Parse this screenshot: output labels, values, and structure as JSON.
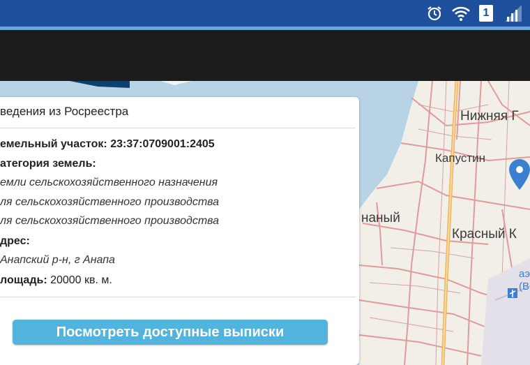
{
  "status_bar": {
    "icons": [
      "alarm-icon",
      "wifi-icon",
      "sim-icon",
      "signal-icon"
    ],
    "sim_badge": "1",
    "color": "#1e4f9c"
  },
  "map": {
    "places": {
      "nizhnyaya": "Нижняя Г",
      "kapustin": "Капустин",
      "krasny": "Красный К",
      "nany": "наный",
      "airport": "аэ",
      "airport_code": "(В"
    },
    "marker_color": "#3b7fd0"
  },
  "panel": {
    "title": "ведения из Росреестра",
    "plot_label": "емельный участок:",
    "plot_value": "23:37:0709001:2405",
    "category_label": "атегория земель:",
    "category_lines": [
      "емли сельскохозяйственного назначения",
      "ля сельскохозяйственного производства",
      "ля сельскохозяйственного производства"
    ],
    "address_label": "дрес:",
    "address_value": " Анапский р-н, г Анапа",
    "area_label": "лощадь:",
    "area_value": " 20000 кв. м.",
    "button_label": "Посмотреть доступные выписки"
  }
}
